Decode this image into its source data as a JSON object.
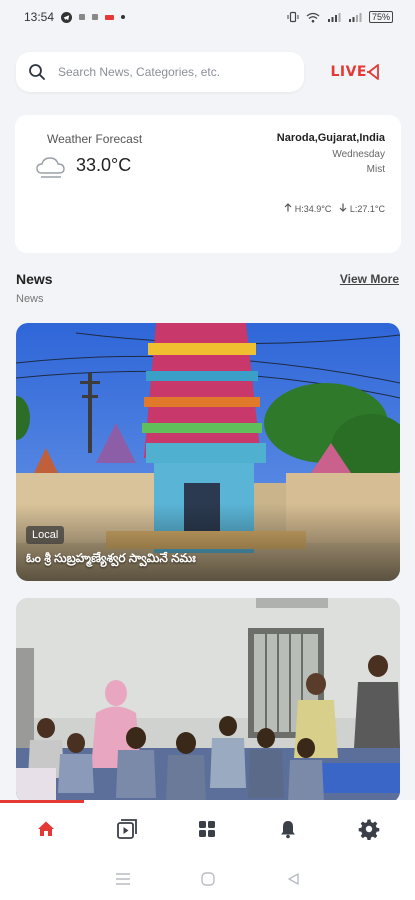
{
  "status_bar": {
    "time": "13:54",
    "battery": "75%"
  },
  "search": {
    "placeholder": "Search News, Categories, etc."
  },
  "live": {
    "label": "LIVE"
  },
  "weather": {
    "title": "Weather Forecast",
    "temperature": "33.0°C",
    "location": "Naroda,Gujarat,India",
    "day": "Wednesday",
    "condition": "Mist",
    "high": "H:34.9°C",
    "low": "L:27.1°C"
  },
  "section": {
    "title": "News",
    "subtitle": "News",
    "view_more": "View More"
  },
  "news_cards": [
    {
      "tag": "Local",
      "title": "ఓం శ్రీ సుబ్రహ్మణ్యేశ్వర స్వామినే నమః"
    },
    {
      "tag": "",
      "title": ""
    }
  ],
  "colors": {
    "accent": "#e53935",
    "background": "#f2f4f8"
  },
  "tabs": [
    {
      "icon": "home-icon",
      "active": true
    },
    {
      "icon": "video-library-icon",
      "active": false
    },
    {
      "icon": "grid-icon",
      "active": false
    },
    {
      "icon": "bell-icon",
      "active": false
    },
    {
      "icon": "gear-icon",
      "active": false
    }
  ]
}
